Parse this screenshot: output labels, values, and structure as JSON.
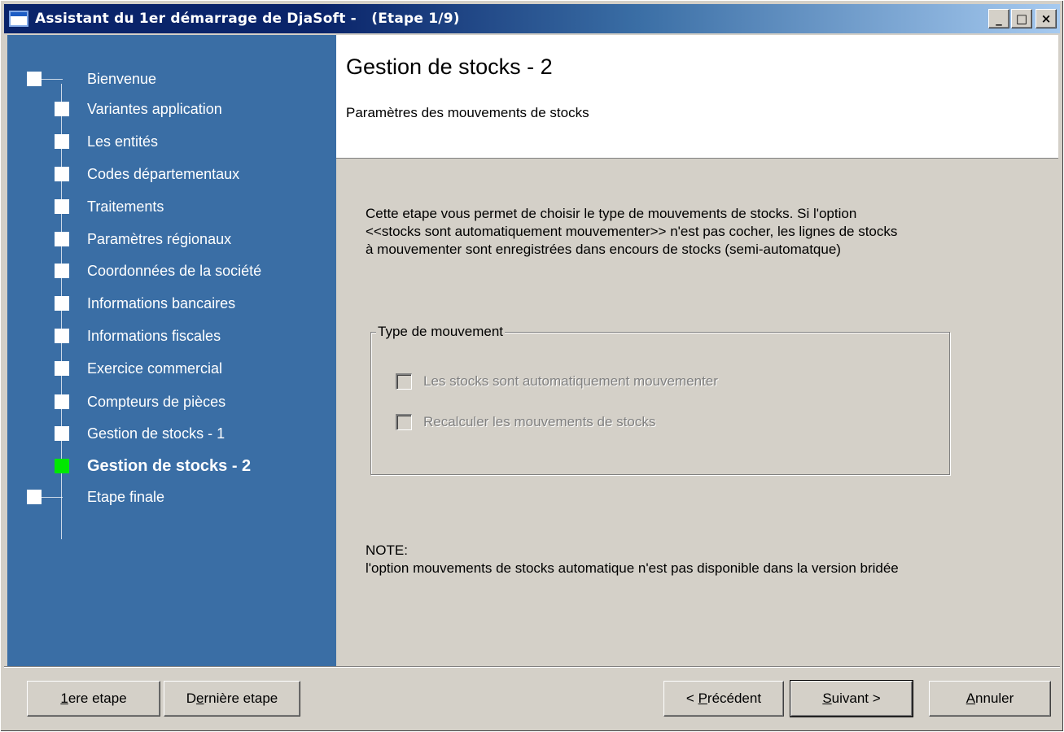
{
  "window": {
    "title": "Assistant du 1er démarrage de DjaSoft -   (Etape 1/9)",
    "controls": {
      "minimize": "_",
      "maximize": "□",
      "close": "×"
    }
  },
  "steps": [
    {
      "label": "Bienvenue",
      "state": "done"
    },
    {
      "label": "Variantes application",
      "state": "done"
    },
    {
      "label": "Les entités",
      "state": "done"
    },
    {
      "label": "Codes départementaux",
      "state": "done"
    },
    {
      "label": "Traitements",
      "state": "done"
    },
    {
      "label": "Paramètres régionaux",
      "state": "done"
    },
    {
      "label": "Coordonnées de la société",
      "state": "done"
    },
    {
      "label": "Informations bancaires",
      "state": "done"
    },
    {
      "label": "Informations fiscales",
      "state": "done"
    },
    {
      "label": "Exercice commercial",
      "state": "done"
    },
    {
      "label": "Compteurs de pièces",
      "state": "done"
    },
    {
      "label": "Gestion de stocks - 1",
      "state": "done"
    },
    {
      "label": "Gestion de stocks - 2",
      "state": "current"
    },
    {
      "label": "Etape finale",
      "state": "pending"
    }
  ],
  "header": {
    "title": "Gestion de stocks - 2",
    "subtitle": "Paramètres des mouvements de stocks"
  },
  "content": {
    "description_lines": [
      "Cette etape vous permet de choisir le type de mouvements de stocks. Si l'option",
      "<<stocks sont automatiquement mouvementer>> n'est pas cocher, les lignes de stocks",
      "à mouvementer sont enregistrées dans encours de stocks (semi-automatque)"
    ],
    "group": {
      "legend": "Type de mouvement",
      "options": [
        {
          "label": "Les stocks sont automatiquement  mouvementer",
          "checked": false,
          "enabled": false
        },
        {
          "label": "Recalculer les mouvements de stocks",
          "checked": false,
          "enabled": false
        }
      ]
    },
    "note_title": "NOTE:",
    "note_text": "l'option mouvements de stocks automatique n'est pas disponible dans la version bridée"
  },
  "buttons": {
    "first_step": {
      "accel": "1",
      "rest": "ere etape"
    },
    "last_step": {
      "pre": "D",
      "accel": "e",
      "rest": "rnière etape"
    },
    "previous": {
      "pre": "< ",
      "accel": "P",
      "rest": "récédent"
    },
    "next": {
      "accel": "S",
      "rest": "uivant >"
    },
    "cancel": {
      "accel": "A",
      "rest": "nnuler"
    }
  },
  "colors": {
    "panel_bg": "#3a6ea5",
    "current_step_marker": "#00e800",
    "window_bg": "#d4d0c8"
  }
}
